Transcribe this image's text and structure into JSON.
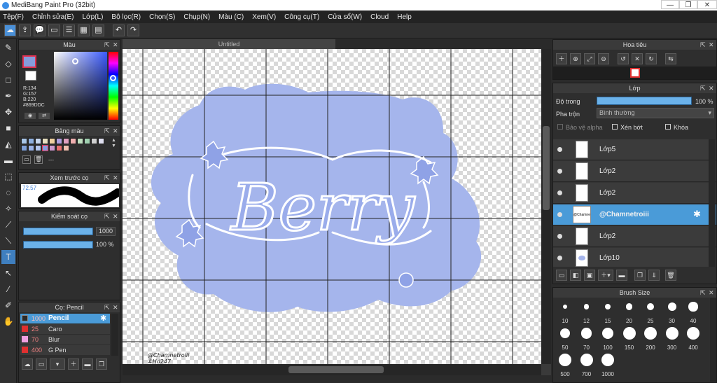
{
  "window": {
    "title": "MediBang Paint Pro (32bit)",
    "minimize": "—",
    "maximize": "❐",
    "close": "✕"
  },
  "menu": [
    "Tệp(F)",
    "Chỉnh sửa(E)",
    "Lớp(L)",
    "Bộ lọc(R)",
    "Chọn(S)",
    "Chụp(N)",
    "Màu (C)",
    "Xem(V)",
    "Công cụ(T)",
    "Cửa sổ(W)",
    "Cloud",
    "Help"
  ],
  "color_panel": {
    "title": "Màu",
    "r": "R:134",
    "g": "G:157",
    "b": "B:220",
    "hex": "#869DDC",
    "main_color": "#869ddc"
  },
  "palette_panel": {
    "title": "Bảng màu",
    "more": "---"
  },
  "brush_preview": {
    "title": "Xem trước cọ",
    "size": "72.57"
  },
  "brush_control": {
    "title": "Kiểm soát cọ",
    "size_value": "1000",
    "opacity_value": "100 %"
  },
  "brush_list": {
    "title": "Cọ: Pencil",
    "items": [
      {
        "size": "1000",
        "name": "Pencil",
        "color": "#2a2a2a"
      },
      {
        "size": "25",
        "name": "Caro",
        "color": "#e03030"
      },
      {
        "size": "70",
        "name": "Blur",
        "color": "#f0a0e0"
      },
      {
        "size": "400",
        "name": "G Pen",
        "color": "#e03030"
      }
    ]
  },
  "canvas": {
    "tab": "Untitled",
    "artwork": {
      "word": "Berry",
      "signature": "@Chamnetroiii",
      "hex_note": "#Hd247",
      "blob_color": "#a5b5ec"
    }
  },
  "navigator": {
    "title": "Hoa tiêu"
  },
  "layers": {
    "title": "Lớp",
    "opacity_label": "Độ trong",
    "opacity_value": "100 %",
    "blend_label": "Pha trộn",
    "blend_value": "Bình thường",
    "protect_alpha": "Bảo vệ alpha",
    "clipping": "Xén bớt",
    "lock": "Khóa",
    "items": [
      {
        "name": "Lớp5"
      },
      {
        "name": "Lớp2"
      },
      {
        "name": "Lớp2"
      },
      {
        "name": "@Chamnetroiii",
        "thumb": "@Chamnetroiii",
        "selected": true
      },
      {
        "name": "Lớp2"
      },
      {
        "name": "Lớp10"
      }
    ]
  },
  "brush_size": {
    "title": "Brush Size",
    "sizes": [
      "10",
      "12",
      "15",
      "20",
      "25",
      "30",
      "40",
      "50",
      "70",
      "100",
      "150",
      "200",
      "300",
      "400",
      "500",
      "700",
      "1000"
    ]
  }
}
